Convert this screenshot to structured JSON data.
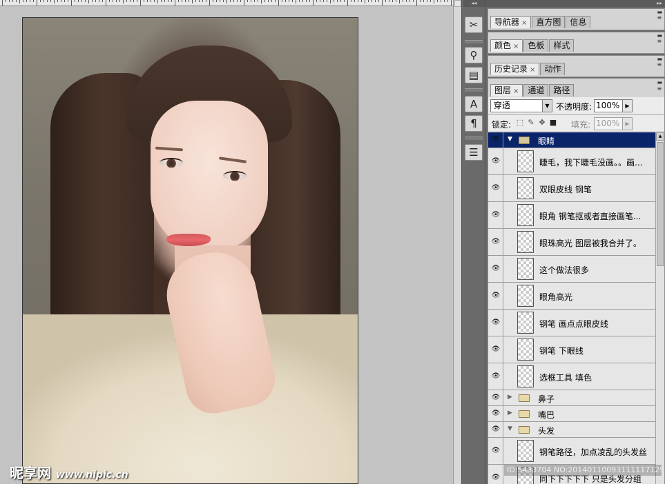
{
  "panels": {
    "dock1_tabs": [
      {
        "label": "导航器",
        "active": true,
        "closable": true
      },
      {
        "label": "直方图",
        "active": false,
        "closable": false
      },
      {
        "label": "信息",
        "active": false,
        "closable": false
      }
    ],
    "dock2_tabs": [
      {
        "label": "颜色",
        "active": true,
        "closable": true
      },
      {
        "label": "色板",
        "active": false,
        "closable": false
      },
      {
        "label": "样式",
        "active": false,
        "closable": false
      }
    ],
    "dock3_tabs": [
      {
        "label": "历史记录",
        "active": true,
        "closable": true
      },
      {
        "label": "动作",
        "active": false,
        "closable": false
      }
    ],
    "close_glyph": "×"
  },
  "layers_panel": {
    "tabs": [
      {
        "label": "图层",
        "active": true,
        "closable": true
      },
      {
        "label": "通道",
        "active": false,
        "closable": false
      },
      {
        "label": "路径",
        "active": false,
        "closable": false
      }
    ],
    "blend_mode": "穿透",
    "opacity_label": "不透明度:",
    "opacity_value": "100%",
    "lock_label": "锁定:",
    "fill_label": "填充:",
    "fill_value": "100%",
    "rows": [
      {
        "type": "group",
        "name": "眼睛",
        "expanded": true,
        "selected": true
      },
      {
        "type": "layer",
        "name": "睫毛，我下睫毛没画。。画..."
      },
      {
        "type": "layer",
        "name": "双眼皮线 钢笔"
      },
      {
        "type": "layer",
        "name": "眼角 钢笔抠或者直接画笔..."
      },
      {
        "type": "layer",
        "name": "眼珠高光 图层被我合并了。"
      },
      {
        "type": "layer",
        "name": "这个做法很多"
      },
      {
        "type": "layer",
        "name": "眼角高光"
      },
      {
        "type": "layer",
        "name": "钢笔 画点点眼皮线"
      },
      {
        "type": "layer",
        "name": "钢笔 下眼线"
      },
      {
        "type": "layer",
        "name": "选框工具 填色"
      },
      {
        "type": "group",
        "name": "鼻子",
        "expanded": false,
        "selected": false
      },
      {
        "type": "group",
        "name": "嘴巴",
        "expanded": false,
        "selected": false
      },
      {
        "type": "group",
        "name": "头发",
        "expanded": true,
        "selected": false
      },
      {
        "type": "layer",
        "name": "钢笔路径，加点凌乱的头发丝"
      },
      {
        "type": "layer",
        "name": "同下下下下下 只是头发分组"
      }
    ]
  },
  "tools": {
    "items": [
      {
        "name": "brush-tools-icon",
        "glyph": "✂"
      },
      {
        "name": "clone-stamp-icon",
        "glyph": "⚲"
      },
      {
        "name": "tool-presets-icon",
        "glyph": "▤"
      },
      {
        "name": "character-icon",
        "glyph": "A"
      },
      {
        "name": "paragraph-icon",
        "glyph": "¶"
      },
      {
        "name": "layer-comps-icon",
        "glyph": "☰"
      }
    ]
  },
  "watermark": {
    "brand": "昵享网",
    "url": "www.nipic.cn"
  },
  "id_text": "ID:5433704 NO:20140110093111117129"
}
